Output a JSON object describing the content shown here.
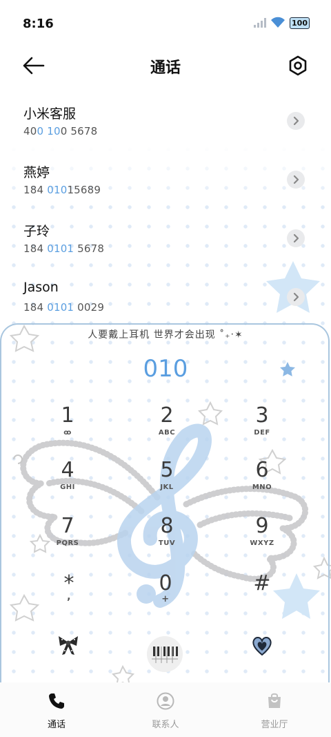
{
  "status_bar": {
    "time": "8:16",
    "battery": "100"
  },
  "header": {
    "title": "通话"
  },
  "contacts": [
    {
      "name": "小米客服",
      "number_parts": [
        "40",
        "0",
        " ",
        "10",
        "0 5678"
      ]
    },
    {
      "name": "燕婷",
      "number_parts": [
        "184 ",
        "010",
        "15689"
      ]
    },
    {
      "name": "子玲",
      "number_parts": [
        "184 ",
        "0101",
        " 5678"
      ]
    },
    {
      "name": "Jason",
      "number_parts": [
        "184 ",
        "0101",
        " 0029"
      ]
    }
  ],
  "dialer": {
    "motto": "人要戴上耳机 世界才会出现 ˚₊‧✶",
    "number": "010",
    "keys": [
      {
        "digit": "1",
        "letters": "ꝏ"
      },
      {
        "digit": "2",
        "letters": "ABC"
      },
      {
        "digit": "3",
        "letters": "DEF"
      },
      {
        "digit": "4",
        "letters": "GHI"
      },
      {
        "digit": "5",
        "letters": "JKL"
      },
      {
        "digit": "6",
        "letters": "MNO"
      },
      {
        "digit": "7",
        "letters": "PQRS"
      },
      {
        "digit": "8",
        "letters": "TUV"
      },
      {
        "digit": "9",
        "letters": "WXYZ"
      },
      {
        "digit": "*",
        "letters": ","
      },
      {
        "digit": "0",
        "letters": "+"
      },
      {
        "digit": "#",
        "letters": ""
      }
    ]
  },
  "tabs": [
    {
      "label": "通话",
      "icon": "phone-icon",
      "active": true
    },
    {
      "label": "联系人",
      "icon": "person-icon",
      "active": false
    },
    {
      "label": "营业厅",
      "icon": "bag-icon",
      "active": false
    }
  ],
  "colors": {
    "accent": "#5a9ee0",
    "panel_border": "#a9c6df",
    "dot": "#dfeaf7"
  }
}
